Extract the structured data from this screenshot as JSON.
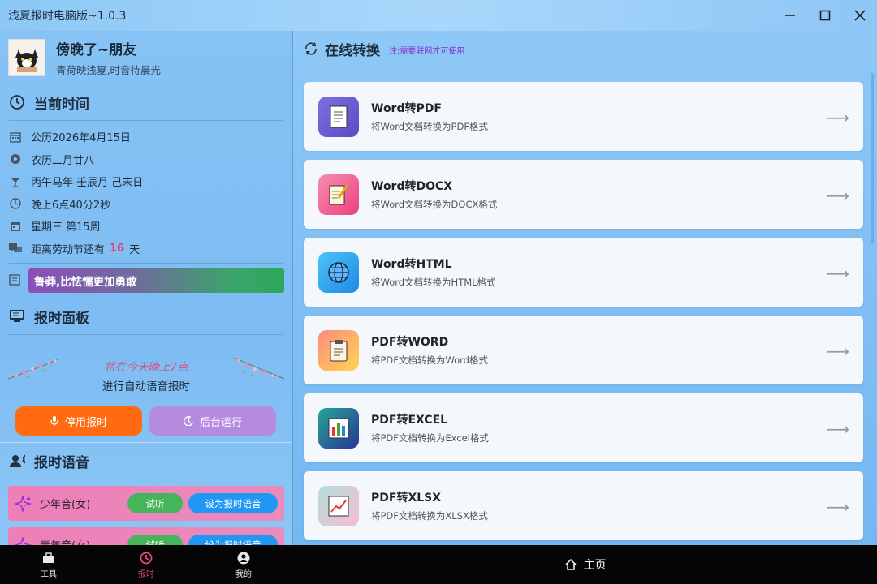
{
  "window": {
    "title": "浅夏报时电脑版~1.0.3"
  },
  "profile": {
    "name": "傍晚了~朋友",
    "motto": "青荷映浅夏,时音待晨光"
  },
  "time_section": {
    "title": "当前时间",
    "rows": [
      {
        "icon": "calendar-icon",
        "text": "公历2026年4月15日"
      },
      {
        "icon": "lunar-icon",
        "text": "农历二月廿八"
      },
      {
        "icon": "cocktail-icon",
        "text": "丙午马年 壬辰月 己未日"
      },
      {
        "icon": "clock-icon",
        "text": "晚上6点40分2秒"
      },
      {
        "icon": "calendar-week-icon",
        "text": "星期三 第15周"
      }
    ],
    "countdown": {
      "prefix": "距离劳动节还有",
      "days": "16",
      "suffix": "天"
    },
    "quote": "鲁莽,比怯懦更加勇敢"
  },
  "panel_section": {
    "title": "报时面板",
    "line1": "将在今天晚上7点",
    "line2": "进行自动语音报时",
    "stop_button": "停用报时",
    "background_button": "后台运行"
  },
  "voice_section": {
    "title": "报时语音",
    "items": [
      {
        "name": "少年音(女)",
        "try": "试听",
        "set": "设为报时语音"
      },
      {
        "name": "青年音(女)",
        "try": "试听",
        "set": "设为报时语音"
      }
    ]
  },
  "bottom_nav": {
    "items": [
      {
        "label": "工具",
        "icon": "toolbox-icon",
        "active": false
      },
      {
        "label": "报时",
        "icon": "clock-icon",
        "active": true
      },
      {
        "label": "我的",
        "icon": "user-icon",
        "active": false
      }
    ],
    "home_label": "主页"
  },
  "convert": {
    "title": "在线转换",
    "note": "注:需要联网才可使用",
    "cards": [
      {
        "title": "Word转PDF",
        "desc": "将Word文档转换为PDF格式",
        "icon": "document-icon",
        "color": "#6b5fd1"
      },
      {
        "title": "Word转DOCX",
        "desc": "将Word文档转换为DOCX格式",
        "icon": "memo-icon",
        "color": "#f06292"
      },
      {
        "title": "Word转HTML",
        "desc": "将Word文档转换为HTML格式",
        "icon": "globe-icon",
        "color": "#29b6f6"
      },
      {
        "title": "PDF转WORD",
        "desc": "将PDF文档转换为Word格式",
        "icon": "clipboard-icon",
        "color": "#ff8a65"
      },
      {
        "title": "PDF转EXCEL",
        "desc": "将PDF文档转换为Excel格式",
        "icon": "bar-chart-icon",
        "color": "#1e88a8"
      },
      {
        "title": "PDF转XLSX",
        "desc": "将PDF文档转换为XLSX格式",
        "icon": "line-chart-icon",
        "color": "#b2dfdb"
      }
    ],
    "arrow": "⟶"
  }
}
